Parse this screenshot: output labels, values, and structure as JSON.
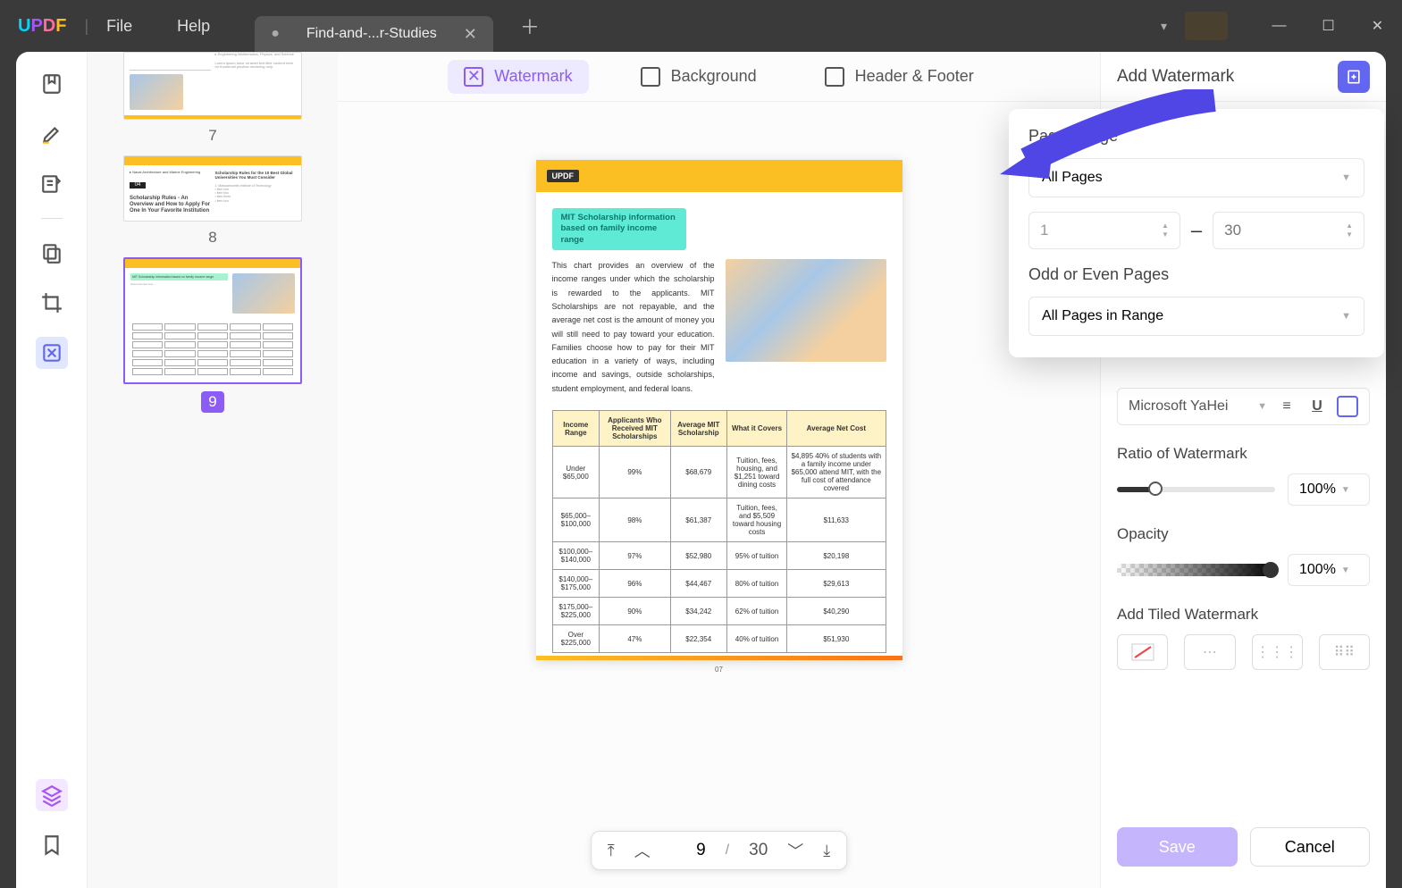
{
  "titlebar": {
    "menu_file": "File",
    "menu_help": "Help",
    "tab_title": "Find-and-...r-Studies"
  },
  "top_tabs": {
    "watermark": "Watermark",
    "background": "Background",
    "header_footer": "Header & Footer"
  },
  "thumbs": {
    "p7": "7",
    "p8": "8",
    "p9": "9",
    "t8_title": "Scholarship Rules - An Overview and How to Apply For One In Your Favorite Institution",
    "t8_box": "04",
    "t8_side": "Scholarship Rules for the 10 Best Global Universities You Must Consider"
  },
  "page": {
    "logo": "UPDF",
    "chip": "MIT Scholarship information based on family income range",
    "para": "This chart provides an overview of the income ranges under which the scholarship is rewarded to the applicants. MIT Scholarships are not repayable, and the average net cost is the amount of money you will still need to pay toward your education. Families choose how to pay for their MIT education in a variety of ways, including income and savings, outside scholarships, student employment, and federal loans.",
    "num": "07"
  },
  "chart_data": {
    "type": "table",
    "headers": [
      "Income Range",
      "Applicants Who Received MIT Scholarships",
      "Average MIT Scholarship",
      "What it Covers",
      "Average Net Cost"
    ],
    "rows": [
      [
        "Under $65,000",
        "99%",
        "$68,679",
        "Tuition, fees, housing, and $1,251 toward dining costs",
        "$4,895 40% of students with a family income under $65,000 attend MIT, with the full cost of attendance covered"
      ],
      [
        "$65,000–$100,000",
        "98%",
        "$61,387",
        "Tuition, fees, and $5,509 toward housing costs",
        "$11,633"
      ],
      [
        "$100,000–$140,000",
        "97%",
        "$52,980",
        "95% of tuition",
        "$20,198"
      ],
      [
        "$140,000–$175,000",
        "96%",
        "$44,467",
        "80% of tuition",
        "$29,613"
      ],
      [
        "$175,000–$225,000",
        "90%",
        "$34,242",
        "62% of tuition",
        "$40,290"
      ],
      [
        "Over $225,000",
        "47%",
        "$22,354",
        "40% of tuition",
        "$51,930"
      ]
    ]
  },
  "pager": {
    "current": "9",
    "total": "30"
  },
  "rpanel": {
    "title": "Add Watermark",
    "font": "Microsoft YaHei",
    "ratio_label": "Ratio of Watermark",
    "ratio_value": "100%",
    "opacity_label": "Opacity",
    "opacity_value": "100%",
    "tiled_label": "Add Tiled Watermark",
    "save": "Save",
    "cancel": "Cancel"
  },
  "popover": {
    "page_range_label": "Page Range",
    "all_pages": "All Pages",
    "from": "1",
    "to": "30",
    "odd_even_label": "Odd or Even Pages",
    "in_range": "All Pages in Range"
  }
}
